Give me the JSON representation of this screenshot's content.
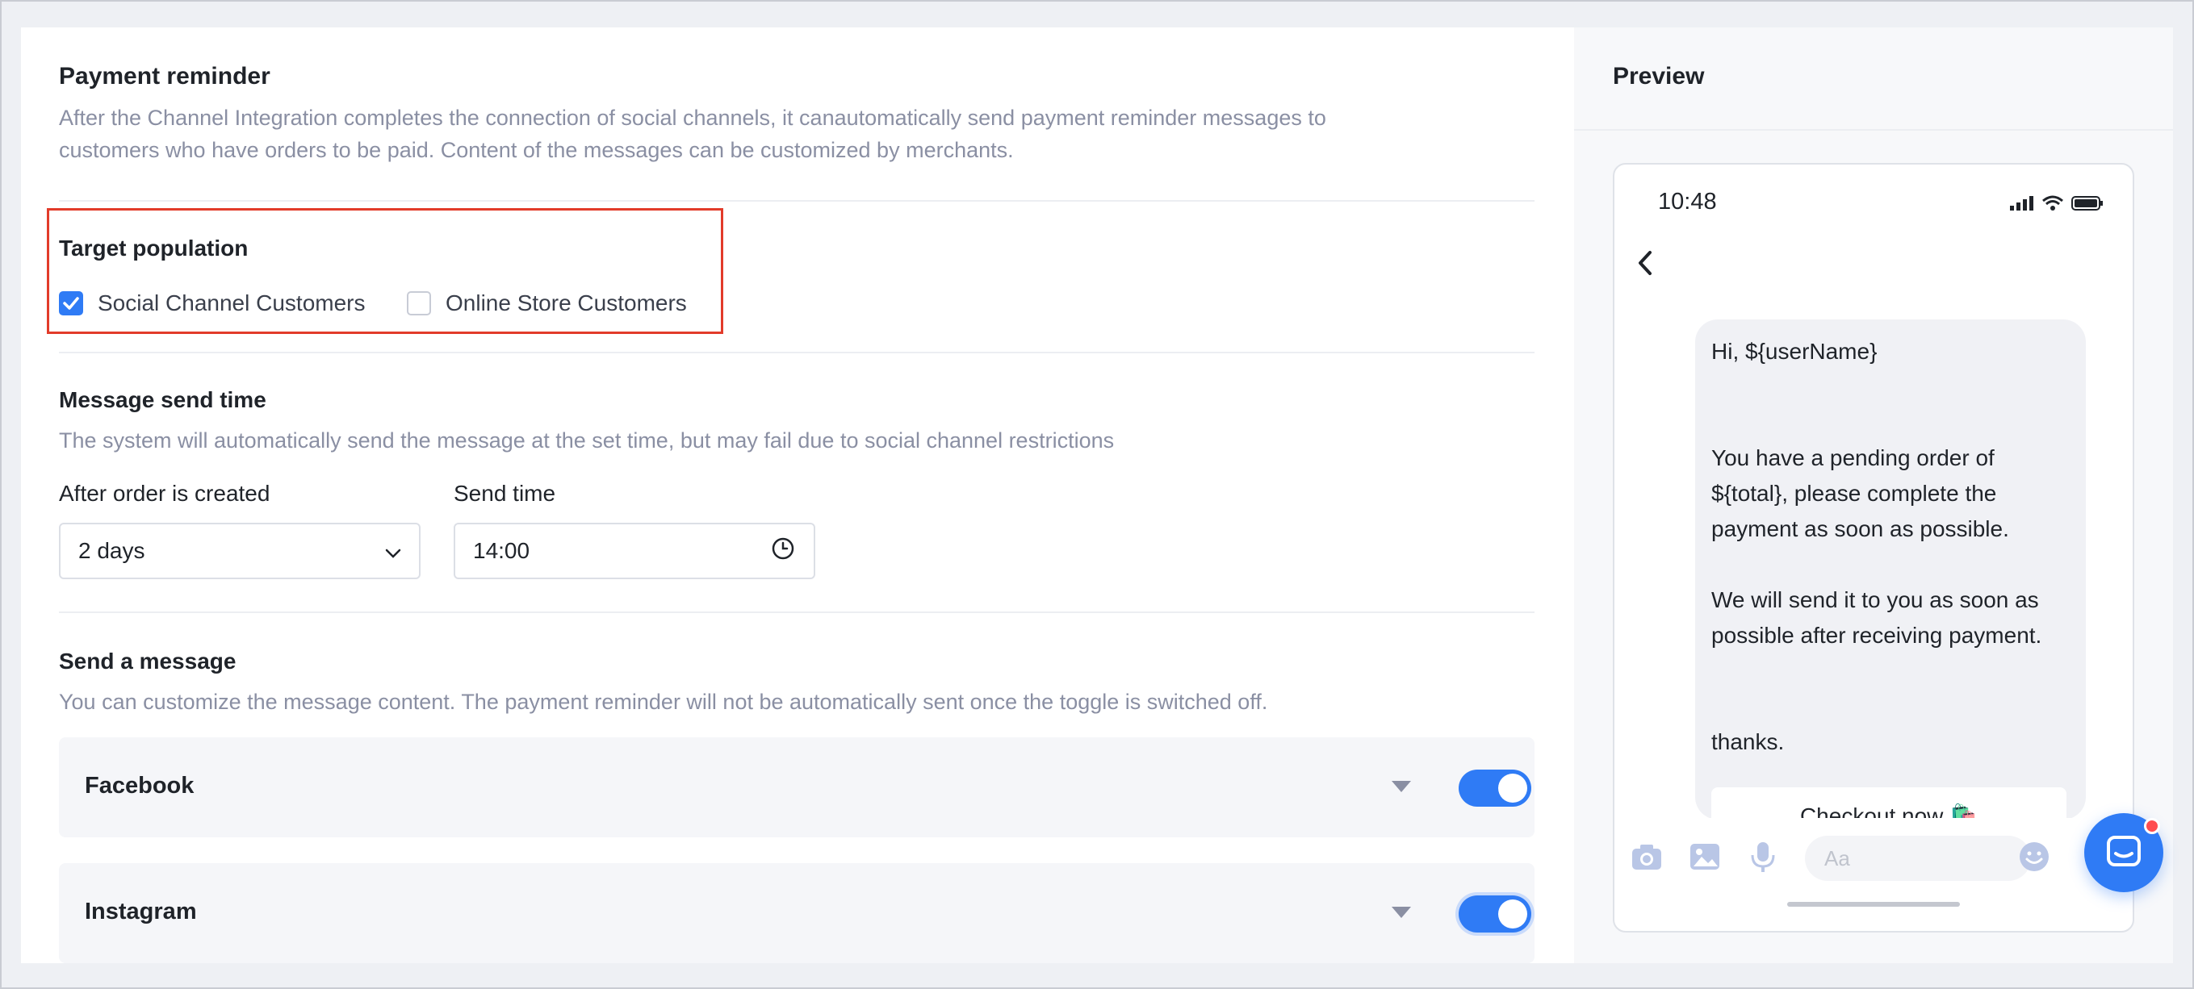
{
  "payment": {
    "title": "Payment reminder",
    "desc_line1": "After the Channel Integration completes the connection of social channels, it canautomatically send payment reminder messages to",
    "desc_line2": "customers who have orders to be paid. Content of the messages can be customized by merchants."
  },
  "target": {
    "title": "Target population",
    "options": [
      {
        "label": "Social Channel Customers",
        "checked": true
      },
      {
        "label": "Online Store Customers",
        "checked": false
      }
    ]
  },
  "send_time": {
    "title": "Message send time",
    "desc": "The system will automatically send the message at the set time, but may fail due to social channel restrictions",
    "after_label": "After order is created",
    "after_value": "2 days",
    "time_label": "Send time",
    "time_value": "14:00"
  },
  "message": {
    "title": "Send a message",
    "desc": "You can customize the message content. The payment reminder will not be automatically sent once the toggle is switched off.",
    "channels": [
      {
        "name": "Facebook",
        "enabled": true
      },
      {
        "name": "Instagram",
        "enabled": true
      }
    ]
  },
  "preview": {
    "title": "Preview",
    "time": "10:48",
    "greeting": "Hi, ${userName}",
    "line1": "You have a pending order of",
    "line2": "${total}, please complete the",
    "line3": "payment as soon as possible.",
    "line4": "We will send it to you as soon as",
    "line5": "possible after receiving payment.",
    "line6": "thanks.",
    "checkout": "Checkout now 🛍️",
    "input_placeholder": "Aa"
  },
  "colors": {
    "accent": "#2f7bf5",
    "highlight": "#e23b2a",
    "notification": "#ff4d4f"
  }
}
